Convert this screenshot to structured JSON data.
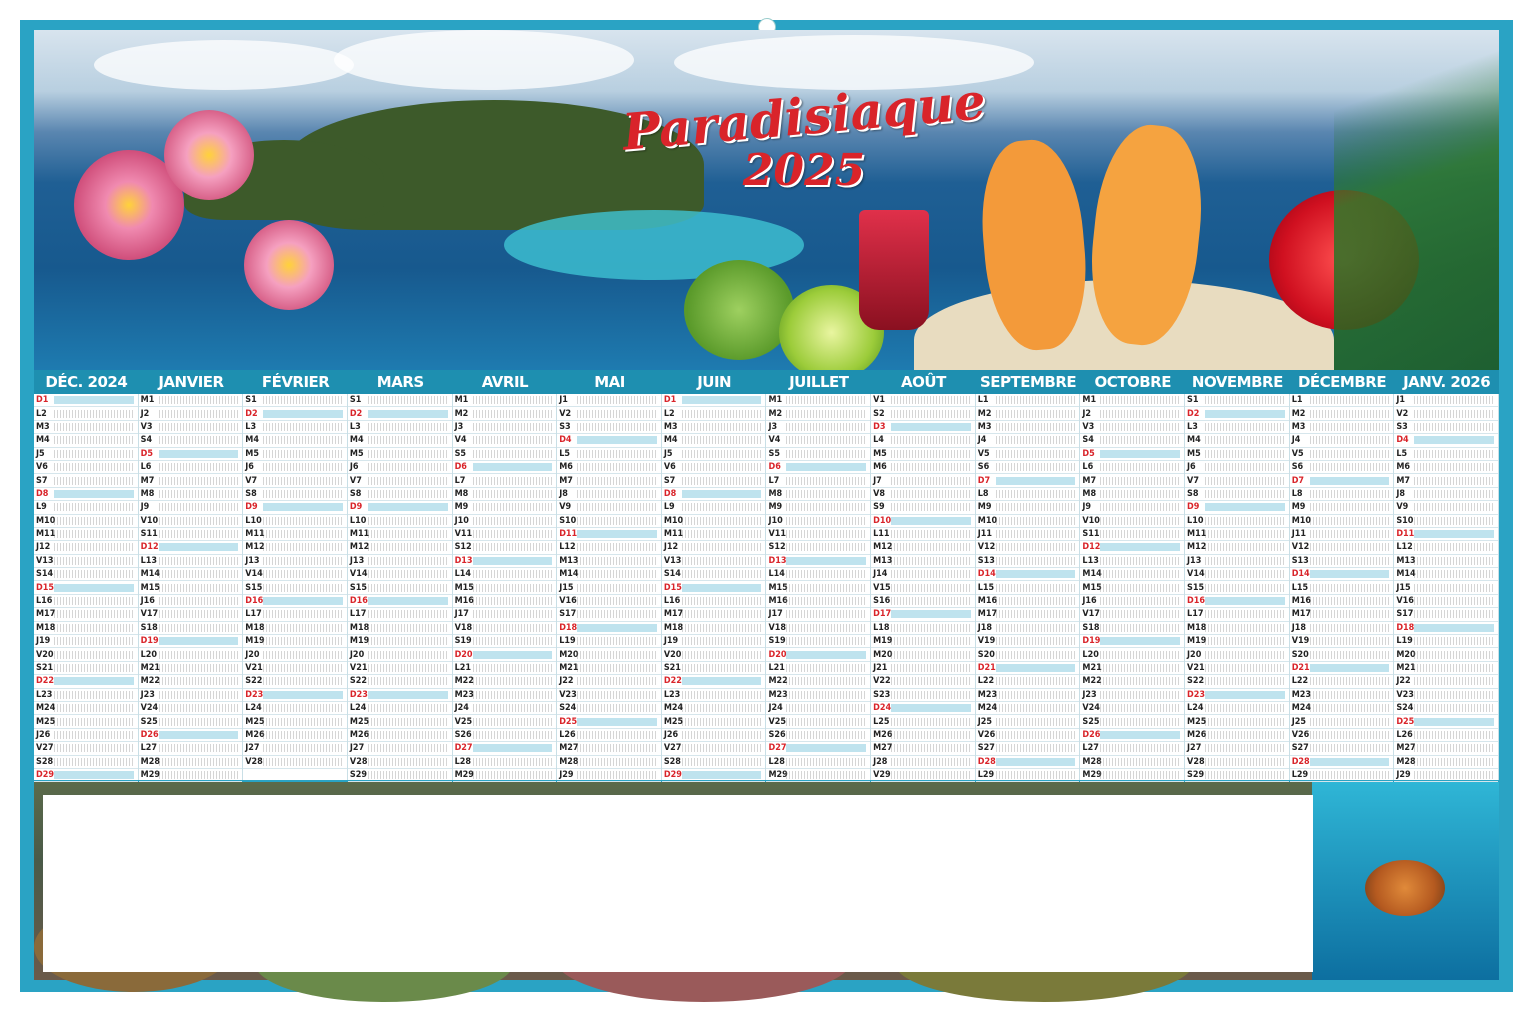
{
  "title": {
    "line1": "Paradisiaque",
    "line2": "2025"
  },
  "months": [
    {
      "label": "DÉC. 2024"
    },
    {
      "label": "JANVIER"
    },
    {
      "label": "FÉVRIER"
    },
    {
      "label": "MARS"
    },
    {
      "label": "AVRIL"
    },
    {
      "label": "MAI"
    },
    {
      "label": "JUIN"
    },
    {
      "label": "JUILLET"
    },
    {
      "label": "AOÛT"
    },
    {
      "label": "SEPTEMBRE"
    },
    {
      "label": "OCTOBRE"
    },
    {
      "label": "NOVEMBRE"
    },
    {
      "label": "DÉCEMBRE"
    },
    {
      "label": "JANV. 2026"
    }
  ],
  "colors": {
    "frame": "#2aa3c4",
    "month_bar": "#1e8fb0",
    "title_red": "#d9242a",
    "highlight": "#bfe3ee"
  }
}
